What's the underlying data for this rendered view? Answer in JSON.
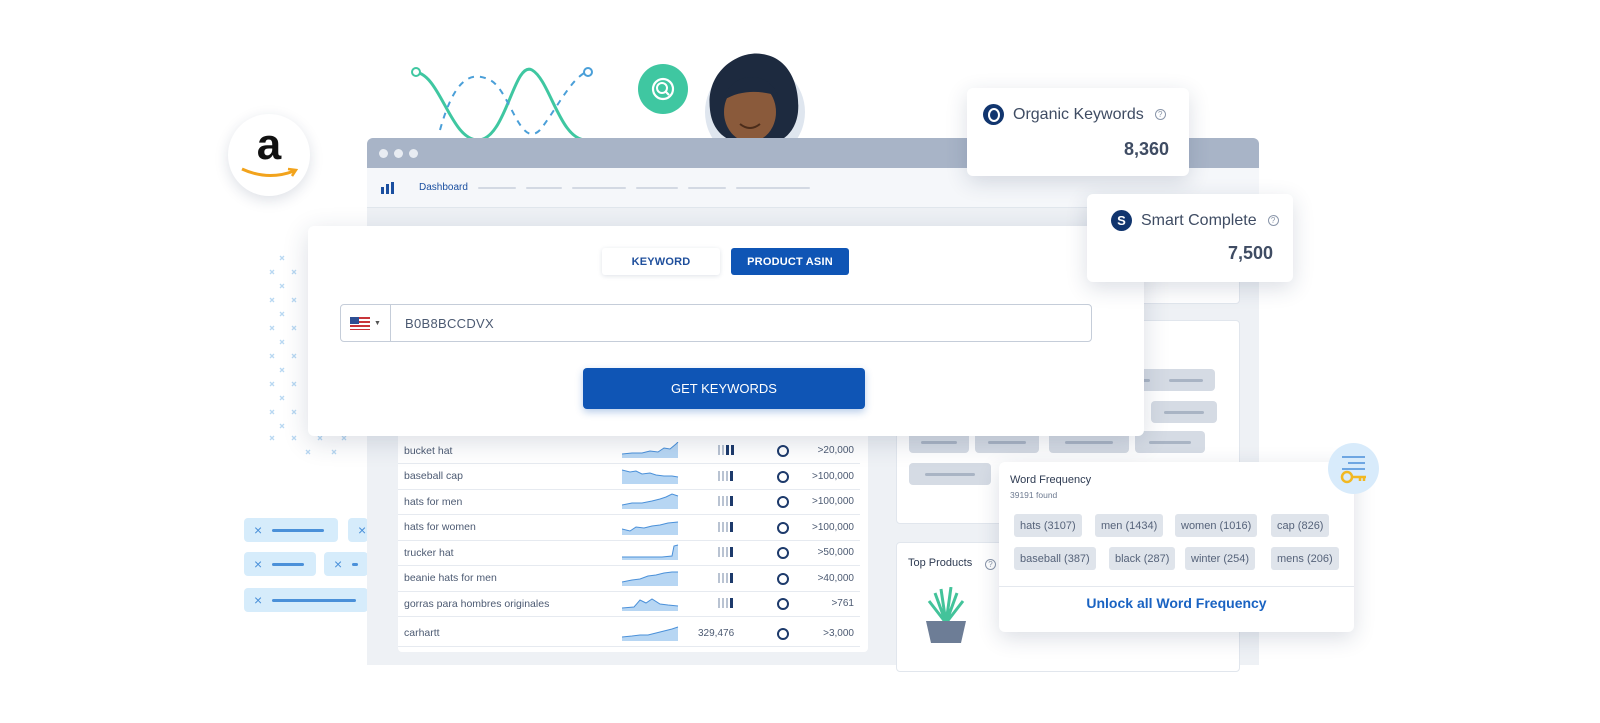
{
  "nav": {
    "dashboard_label": "Dashboard"
  },
  "tabs": {
    "keyword_label": "KEYWORD",
    "asin_label": "PRODUCT ASIN"
  },
  "search": {
    "asin_value": "B0B8BCCDVX",
    "country": "US",
    "button_label": "GET KEYWORDS"
  },
  "stats": {
    "organic": {
      "label": "Organic Keywords",
      "value": "8,360"
    },
    "smart": {
      "label": "Smart Complete",
      "value": "7,500"
    }
  },
  "keywords": [
    {
      "term": "bucket hat",
      "volume": ">20,000",
      "number": ""
    },
    {
      "term": "baseball cap",
      "volume": ">100,000",
      "number": ""
    },
    {
      "term": "hats for men",
      "volume": ">100,000",
      "number": ""
    },
    {
      "term": "hats for women",
      "volume": ">100,000",
      "number": ""
    },
    {
      "term": "trucker hat",
      "volume": ">50,000",
      "number": ""
    },
    {
      "term": "beanie hats for men",
      "volume": ">40,000",
      "number": ""
    },
    {
      "term": "gorras para hombres originales",
      "volume": ">761",
      "number": ""
    },
    {
      "term": "carhartt",
      "volume": ">3,000",
      "number": "329,476"
    }
  ],
  "top_products": {
    "title": "Top Products"
  },
  "word_frequency": {
    "title": "Word Frequency",
    "found": "39191 found",
    "tags": [
      "hats (3107)",
      "men (1434)",
      "women (1016)",
      "cap (826)",
      "baseball (387)",
      "black (287)",
      "winter (254)",
      "mens (206)"
    ],
    "unlock_label": "Unlock all Word Frequency"
  },
  "colors": {
    "primary": "#0f55b5",
    "navy": "#11356e",
    "accent_green": "#3fc7a1",
    "link": "#1a63c2"
  }
}
